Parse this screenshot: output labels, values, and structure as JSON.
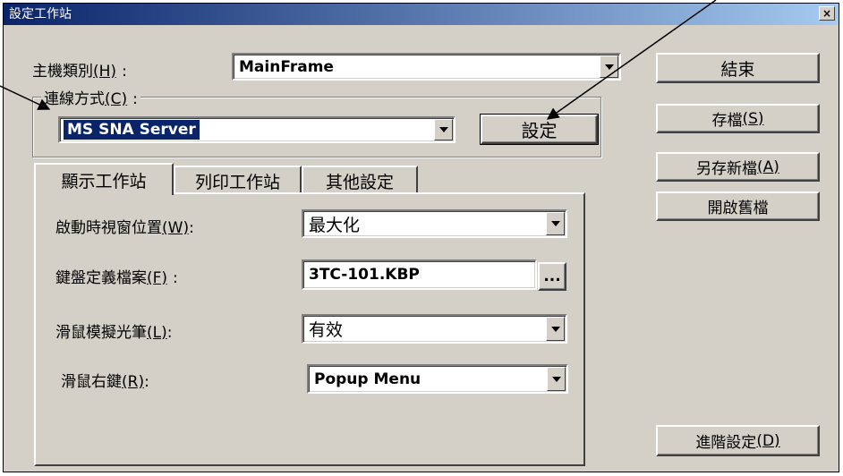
{
  "window": {
    "title": "設定工作站",
    "close_glyph": "×"
  },
  "host_type": {
    "label": "主機類別",
    "mnemonic": "(H)",
    "colon": ":",
    "value": "MainFrame"
  },
  "connection": {
    "label": "連線方式",
    "mnemonic": "(C)",
    "colon": ":",
    "value": "MS SNA Server",
    "settings_button": "設定"
  },
  "tabs": [
    "顯示工作站",
    "列印工作站",
    "其他設定"
  ],
  "fields": {
    "startup_position": {
      "label": "啟動時視窗位置",
      "mnemonic": "(W)",
      "colon": ":",
      "value": "最大化"
    },
    "keyboard_file": {
      "label": "鍵盤定義檔案",
      "mnemonic": "(F)",
      "colon": ":",
      "value": "3TC-101.KBP",
      "browse": "..."
    },
    "mouse_lightpen": {
      "label": "滑鼠模擬光筆",
      "mnemonic": "(L)",
      "colon": ":",
      "value": "有效"
    },
    "mouse_right": {
      "label": "滑鼠右鍵",
      "mnemonic": "(R)",
      "colon": ":",
      "value": "Popup Menu"
    }
  },
  "buttons": {
    "close": "結束",
    "save": "存檔",
    "save_mnemonic": "(S)",
    "save_as": "另存新檔",
    "save_as_mnemonic": "(A)",
    "open_old": "開啟舊檔",
    "advanced": "進階設定",
    "advanced_mnemonic": "(D)"
  }
}
